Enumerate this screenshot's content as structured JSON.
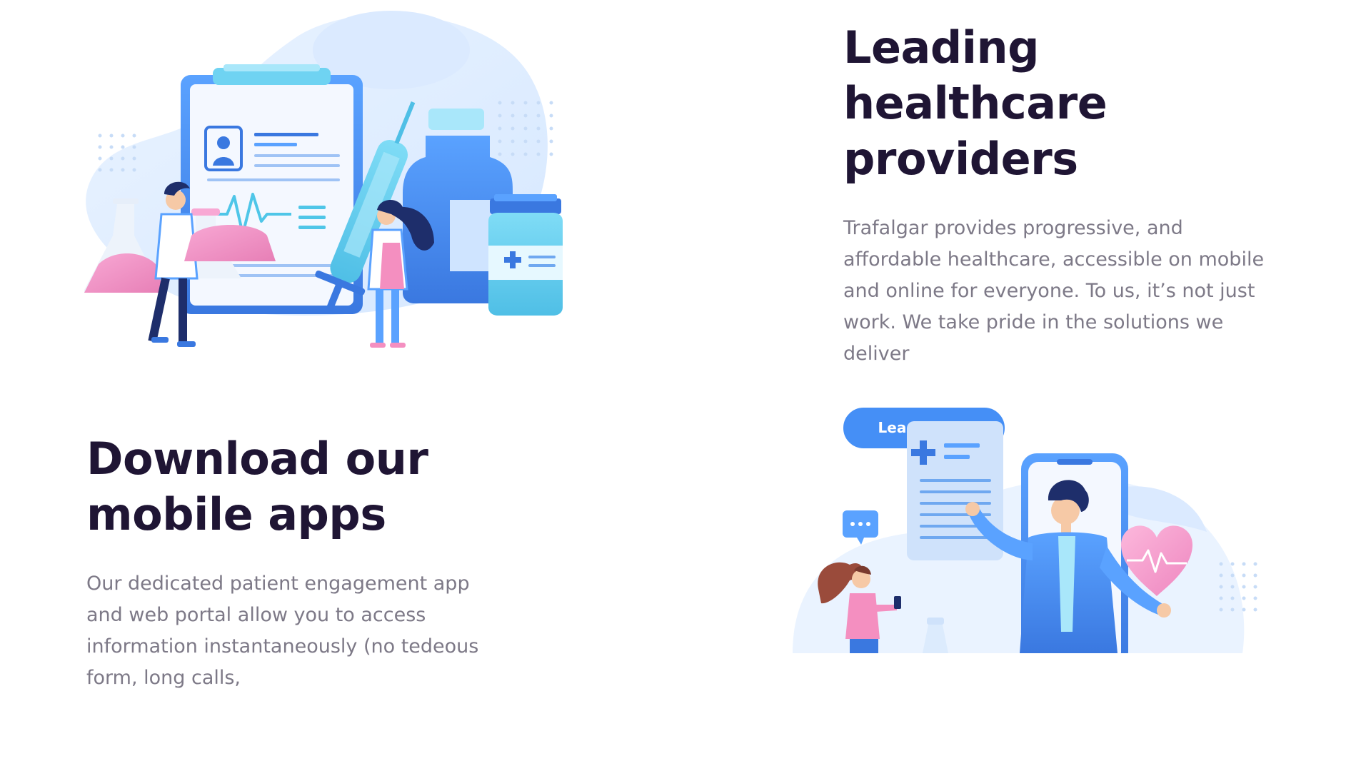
{
  "section_healthcare": {
    "title": "Leading healthcare providers",
    "description": "Trafalgar provides progressive, and affordable healthcare, accessible on mobile and online for everyone. To us, it’s not just work. We take pride in the solutions we deliver",
    "cta_label": "Learn more",
    "illustration_icon": "medical-team-illustration"
  },
  "section_mobile": {
    "title": "Download our mobile apps",
    "description": "Our dedicated patient engagement app and web portal allow you to access information instantaneously (no tedeous form, long calls,",
    "illustration_icon": "doctor-phone-illustration"
  },
  "colors": {
    "primary": "#458ff6",
    "heading": "#1f1534",
    "text": "#7d7987",
    "pink": "#f48fc0",
    "light_blue": "#e8f1ff"
  }
}
